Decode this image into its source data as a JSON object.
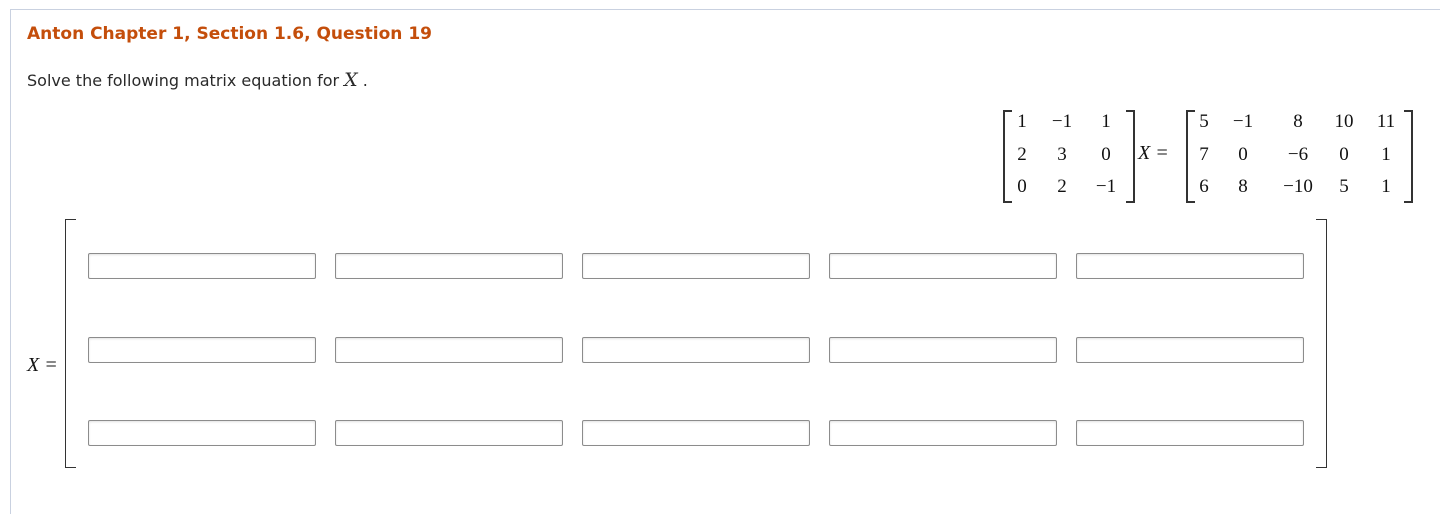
{
  "question": {
    "title": "Anton Chapter 1, Section 1.6, Question 19",
    "prompt_text": "Solve the following matrix equation for",
    "prompt_var": "X",
    "prompt_end": " ."
  },
  "equation": {
    "matrix_a": [
      [
        "1",
        "−1",
        "1"
      ],
      [
        "2",
        "3",
        "0"
      ],
      [
        "0",
        "2",
        "−1"
      ]
    ],
    "middle": "X =",
    "matrix_b": [
      [
        "5",
        "−1",
        "8",
        "10",
        "11"
      ],
      [
        "7",
        "0",
        "−6",
        "0",
        "1"
      ],
      [
        "6",
        "8",
        "−10",
        "5",
        "1"
      ]
    ]
  },
  "answer": {
    "label": "X =",
    "rows": 3,
    "cols": 5,
    "values": [
      [
        "",
        "",
        "",
        "",
        ""
      ],
      [
        "",
        "",
        "",
        "",
        ""
      ],
      [
        "",
        "",
        "",
        "",
        ""
      ]
    ]
  }
}
